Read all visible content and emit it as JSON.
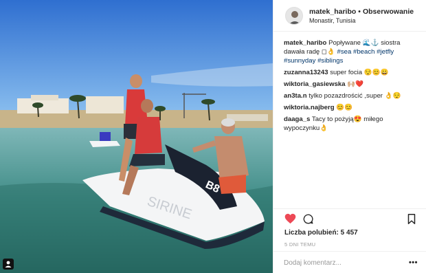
{
  "post": {
    "image_alt": "",
    "header": {
      "username": "matek_haribo",
      "separator": "•",
      "follow_label": "Obserwowanie",
      "location": "Monastir, Tunisia"
    },
    "caption": {
      "username": "matek_haribo",
      "text_a": "Popływane 🌊⚓ siostra dawała radę ◻👌",
      "hashtags": [
        "#sea",
        "#beach",
        "#jetfly",
        "#sunnyday",
        "#siblings"
      ]
    },
    "comments": [
      {
        "user": "zuzanna13243",
        "text": "super focia 😌😊😀"
      },
      {
        "user": "wiktoria_gasiewska",
        "text": "🙌🏼❤️"
      },
      {
        "user": "an3ta.n",
        "text": "tylko pozazdrościć ,super 👌😌"
      },
      {
        "user": "wiktoria.najberg",
        "text": "😊😊"
      },
      {
        "user": "daaga_s",
        "text": "Tacy to pożyją😍 miłego wypoczynku👌"
      }
    ],
    "likes_text": "Liczba polubień: 5 457",
    "time_text": "5 DNI TEMU",
    "add_comment_placeholder": "Dodaj komentarz...",
    "more_label": "•••",
    "jetski_text_a": "SIRINE",
    "jetski_text_b": "B8"
  },
  "colors": {
    "heart": "#ed4956",
    "link": "#003569",
    "muted": "#999999",
    "border": "#efefef"
  },
  "icons": [
    "heart-icon",
    "comment-icon",
    "bookmark-icon",
    "user-tag-icon",
    "more-options-icon"
  ]
}
